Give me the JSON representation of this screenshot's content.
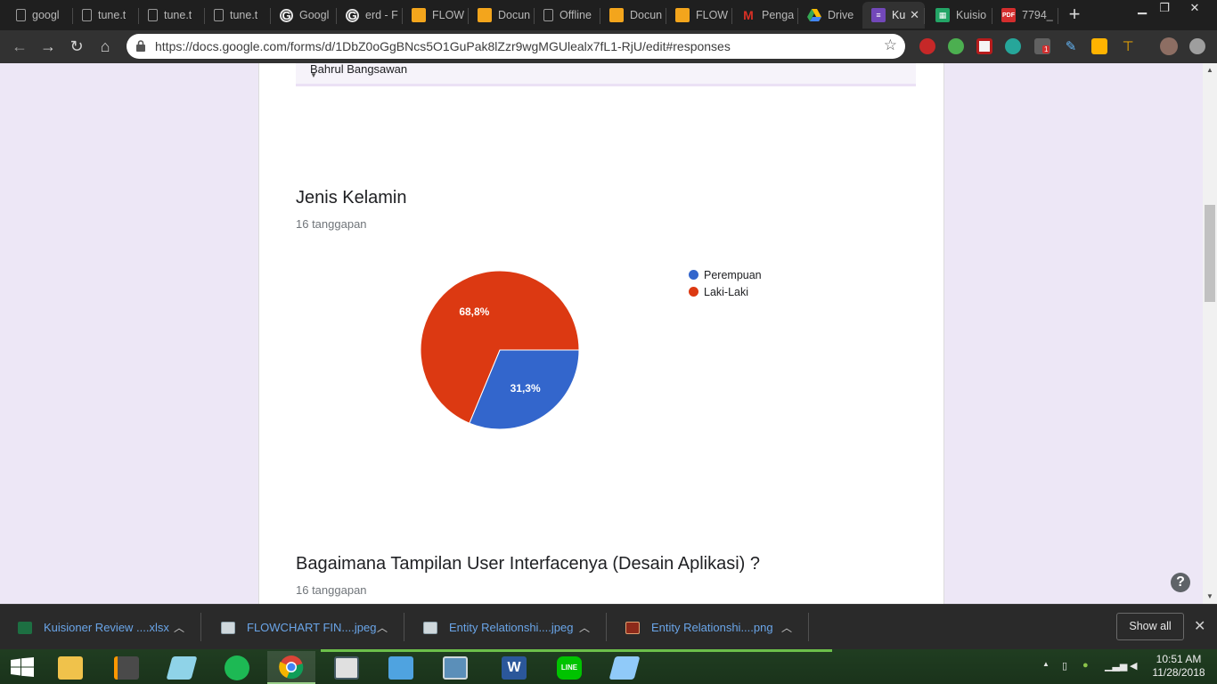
{
  "browser": {
    "tabs": [
      {
        "label": "googl",
        "icon": "doc-icon"
      },
      {
        "label": "tune.t",
        "icon": "doc-icon"
      },
      {
        "label": "tune.t",
        "icon": "doc-icon"
      },
      {
        "label": "tune.t",
        "icon": "doc-icon"
      },
      {
        "label": "Googl",
        "icon": "google-icon"
      },
      {
        "label": "erd - F",
        "icon": "google-icon"
      },
      {
        "label": "FLOW",
        "icon": "drawio-icon"
      },
      {
        "label": "Docun",
        "icon": "drawio-icon"
      },
      {
        "label": "Offline",
        "icon": "doc-icon"
      },
      {
        "label": "Docun",
        "icon": "drawio-icon"
      },
      {
        "label": "FLOW",
        "icon": "drawio-icon"
      },
      {
        "label": "Penga",
        "icon": "gmail-icon"
      },
      {
        "label": "Drive",
        "icon": "drive-icon"
      },
      {
        "label": "Ku",
        "icon": "forms-icon",
        "active": true
      },
      {
        "label": "Kuisio",
        "icon": "sheets-icon"
      },
      {
        "label": "7794_",
        "icon": "pdf-icon"
      }
    ],
    "url": "https://docs.google.com/forms/d/1DbZ0oGgBNcs5O1GuPak8lZzr9wgMGUlealx7fL1-RjU/edit#responses",
    "extension_badge": "1"
  },
  "form": {
    "previous_response": "Bahrul Bangsawan",
    "question1": {
      "title": "Jenis Kelamin",
      "count": "16 tanggapan"
    },
    "question2": {
      "title": "Bagaimana Tampilan User Interfacenya (Desain Aplikasi) ?",
      "count": "16 tanggapan"
    },
    "help_label": "?"
  },
  "chart_data": {
    "type": "pie",
    "title": "Jenis Kelamin",
    "labels": [
      "Perempuan",
      "Laki-Laki"
    ],
    "values": [
      31.3,
      68.8
    ],
    "value_labels": [
      "31,3%",
      "68,8%"
    ],
    "colors": [
      "#3366cc",
      "#dc3912"
    ],
    "legend": "right"
  },
  "downloads": [
    {
      "name": "Kuisioner Review ....xlsx",
      "icon": "excel-icon"
    },
    {
      "name": "FLOWCHART FIN....jpeg",
      "icon": "image-icon"
    },
    {
      "name": "Entity Relationshi....jpeg",
      "icon": "image-icon"
    },
    {
      "name": "Entity Relationshi....png",
      "icon": "image-icon"
    }
  ],
  "shelf": {
    "show_all": "Show all"
  },
  "taskbar": {
    "time": "10:51 AM",
    "date": "11/28/2018"
  }
}
